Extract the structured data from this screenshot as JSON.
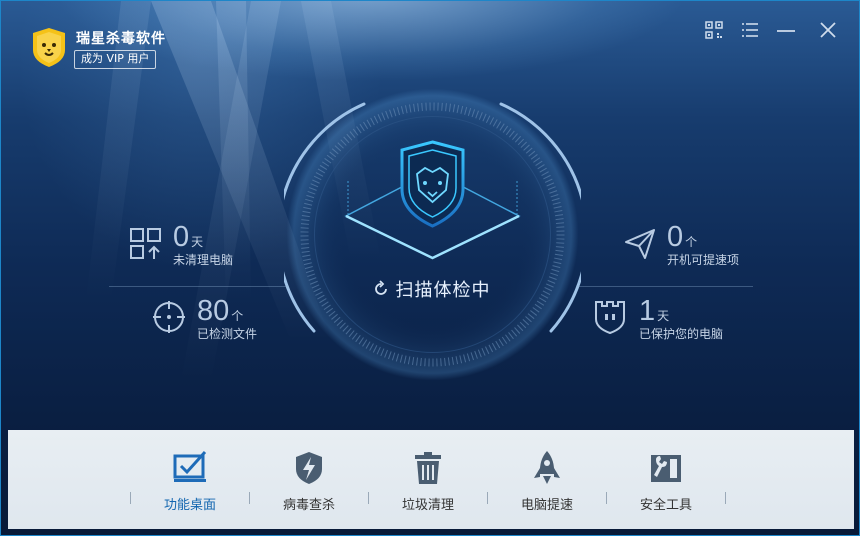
{
  "app": {
    "title": "瑞星杀毒软件",
    "vip_label": "成为 VIP 用户"
  },
  "titlebar": {
    "icons": [
      "qrcode-icon",
      "menu-icon",
      "minimize-icon",
      "close-icon"
    ]
  },
  "scan": {
    "status": "扫描体检中"
  },
  "stats": {
    "uncleaned": {
      "value": "0",
      "unit": "天",
      "label": "未清理电脑"
    },
    "checked_files": {
      "value": "80",
      "unit": "个",
      "label": "已检测文件"
    },
    "boost_items": {
      "value": "0",
      "unit": "个",
      "label": "开机可提速项"
    },
    "protected_days": {
      "value": "1",
      "unit": "天",
      "label": "已保护您的电脑"
    }
  },
  "nav": {
    "items": [
      {
        "label": "功能桌面",
        "icon": "desktop-check-icon",
        "active": true
      },
      {
        "label": "病毒查杀",
        "icon": "shield-bolt-icon",
        "active": false
      },
      {
        "label": "垃圾清理",
        "icon": "trash-icon",
        "active": false
      },
      {
        "label": "电脑提速",
        "icon": "rocket-icon",
        "active": false
      },
      {
        "label": "安全工具",
        "icon": "toolbox-icon",
        "active": false
      }
    ]
  },
  "colors": {
    "accent_blue": "#1e6bb8",
    "active_label": "#1366b0",
    "bg_deep": "#0a1f42",
    "logo_gold": "#f5c218",
    "cyan_glow": "#4fc3ff"
  }
}
